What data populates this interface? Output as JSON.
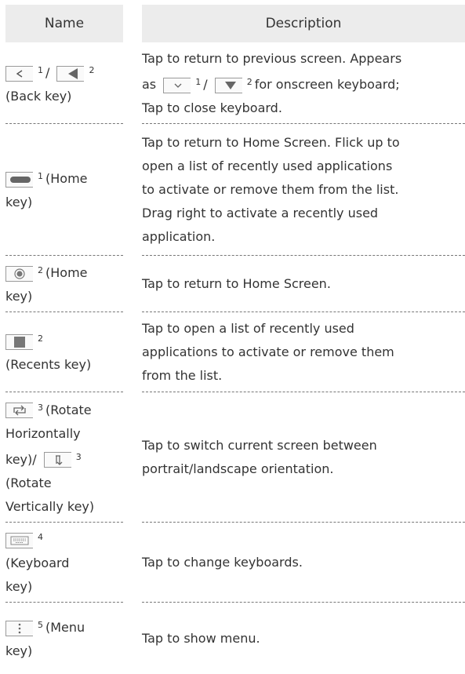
{
  "header": {
    "name": "Name",
    "description": "Description"
  },
  "rows": [
    {
      "name": {
        "sup1": "1",
        "slash": "/",
        "sup2": "2",
        "label": "(Back key)"
      },
      "desc": {
        "line1": "Tap to return to previous screen. Appears",
        "as": "as",
        "sup1": "1",
        "slash": "/",
        "sup2": "2",
        "tail": "for onscreen keyboard;",
        "line3": "Tap to close keyboard."
      }
    },
    {
      "name": {
        "sup": "1",
        "label_a": "(Home",
        "label_b": "key)"
      },
      "desc": {
        "line1": "Tap to return to Home Screen. Flick up to",
        "line2": "open a list of recently used applications",
        "line3": "to activate or remove them from the list.",
        "line4": "Drag right to activate a recently used",
        "line5": "application."
      }
    },
    {
      "name": {
        "sup": "2",
        "label_a": "(Home",
        "label_b": "key)"
      },
      "desc": {
        "line1": "Tap to return to Home Screen."
      }
    },
    {
      "name": {
        "sup": "2",
        "label_a": "(Recents key)"
      },
      "desc": {
        "line1": "Tap to open a list of recently used",
        "line2": "applications to activate or remove them",
        "line3": "from the list."
      }
    },
    {
      "name": {
        "sup1": "3",
        "label_a": "(Rotate",
        "label_b": "Horizontally",
        "label_c": "key)/",
        "sup2": "3",
        "label_d": "(Rotate",
        "label_e": "Vertically key)"
      },
      "desc": {
        "line1": "Tap to switch current screen between",
        "line2": "portrait/landscape orientation."
      }
    },
    {
      "name": {
        "sup": "4",
        "label_a": "(Keyboard",
        "label_b": "key)"
      },
      "desc": {
        "line1": "Tap to change keyboards."
      }
    },
    {
      "name": {
        "sup": "5",
        "label_a": "(Menu",
        "label_b": "key)"
      },
      "desc": {
        "line1": "Tap to show menu."
      }
    }
  ]
}
